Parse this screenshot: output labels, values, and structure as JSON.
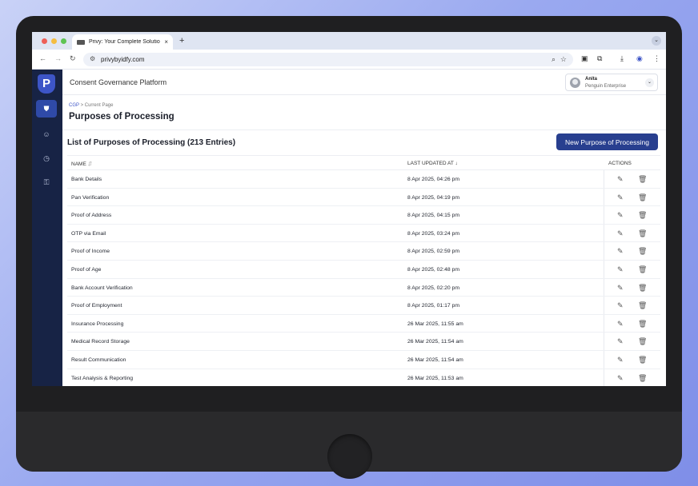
{
  "browser": {
    "tab_title": "Privy: Your Complete Solution",
    "tab_close": "×",
    "new_tab": "+",
    "tab_menu": "⌄",
    "url": "privybyidfy.com"
  },
  "app": {
    "platform_title": "Consent Governance Platform",
    "user": {
      "name": "Anita",
      "org": "Penguin Enterprise"
    },
    "logo_letter": "P"
  },
  "breadcrumb": {
    "root": "CGP",
    "separator": ">",
    "current": "Current Page"
  },
  "page_title": "Purposes of Processing",
  "list": {
    "title": "List of Purposes of Processing (213 Entries)",
    "new_button": "New Purpose of Processing"
  },
  "table": {
    "columns": {
      "name": "NAME",
      "updated": "LAST UPDATED AT",
      "actions": "ACTIONS"
    },
    "rows": [
      {
        "name": "Bank Details",
        "updated": "8 Apr 2025, 04:26 pm"
      },
      {
        "name": "Pan Verification",
        "updated": "8 Apr 2025, 04:19 pm"
      },
      {
        "name": "Proof of Address",
        "updated": "8 Apr 2025, 04:15 pm"
      },
      {
        "name": "OTP via Email",
        "updated": "8 Apr 2025, 03:24 pm"
      },
      {
        "name": "Proof of Income",
        "updated": "8 Apr 2025, 02:59 pm"
      },
      {
        "name": "Proof of Age",
        "updated": "8 Apr 2025, 02:48 pm"
      },
      {
        "name": "Bank Account Verification",
        "updated": "8 Apr 2025, 02:20 pm"
      },
      {
        "name": "Proof of Employment",
        "updated": "8 Apr 2025, 01:17 pm"
      },
      {
        "name": "Insurance Processing",
        "updated": "26 Mar 2025, 11:55 am"
      },
      {
        "name": "Medical Record Storage",
        "updated": "26 Mar 2025, 11:54 am"
      },
      {
        "name": "Result Communication",
        "updated": "26 Mar 2025, 11:54 am"
      },
      {
        "name": "Test Analysis & Reporting",
        "updated": "26 Mar 2025, 11:53 am"
      }
    ]
  },
  "colors": {
    "sidebar": "#172345",
    "accent": "#283f8f",
    "sidebar_active": "#2f4aa8"
  },
  "icons": {
    "sidebar": [
      "shield-icon",
      "user-settings-icon",
      "clock-icon",
      "key-icon"
    ],
    "row_actions": [
      "edit-icon",
      "trash-icon"
    ]
  }
}
